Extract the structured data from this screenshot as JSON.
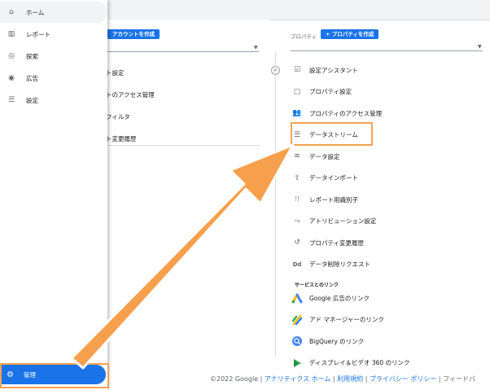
{
  "sidebar": {
    "items": [
      {
        "label": "ホーム",
        "icon": "home-icon"
      },
      {
        "label": "レポート",
        "icon": "bar-chart-icon"
      },
      {
        "label": "探索",
        "icon": "explore-icon"
      },
      {
        "label": "広告",
        "icon": "ads-icon"
      },
      {
        "label": "設定",
        "icon": "list-icon"
      }
    ],
    "admin_label": "管理"
  },
  "account": {
    "create_button": "アカウントを作成",
    "items": [
      "ト設定",
      "トのアクセス管理",
      "フィルタ",
      "ト変更履歴"
    ]
  },
  "property": {
    "header_label": "プロパティ",
    "create_button": "+ プロパティを作成",
    "items": [
      {
        "label": "設定アシスタント",
        "icon": "check-box-icon"
      },
      {
        "label": "プロパティ設定",
        "icon": "square-icon"
      },
      {
        "label": "プロパティのアクセス管理",
        "icon": "people-icon"
      },
      {
        "label": "データストリーム",
        "icon": "stream-icon"
      },
      {
        "label": "データ設定",
        "icon": "database-icon"
      },
      {
        "label": "データインポート",
        "icon": "upload-icon"
      },
      {
        "label": "レポート用識別子",
        "icon": "identifier-icon"
      },
      {
        "label": "アトリビューション設定",
        "icon": "attribution-icon"
      },
      {
        "label": "プロパティ変更履歴",
        "icon": "history-icon"
      },
      {
        "label": "データ削除リクエスト",
        "icon": "dd-icon"
      }
    ],
    "links_title": "サービスとのリンク",
    "links": [
      {
        "label": "Google 広告のリンク",
        "icon": "google-ads-icon"
      },
      {
        "label": "アド マネージャーのリンク",
        "icon": "ad-manager-icon"
      },
      {
        "label": "BigQuery のリンク",
        "icon": "bigquery-icon"
      },
      {
        "label": "ディスプレイ＆ビデオ 360 のリンク",
        "icon": "dv360-icon"
      }
    ]
  },
  "footer": {
    "copyright": "©2022 Google |",
    "home_link": "アナリティクス ホーム",
    "sep1": "|",
    "terms_link": "利用規約",
    "sep2": "|",
    "privacy_link": "プライバシー ポリシー",
    "sep3": "|",
    "feedback": "フィードバ"
  },
  "colors": {
    "accent": "#1a73e8",
    "annotation": "#f4a253"
  }
}
